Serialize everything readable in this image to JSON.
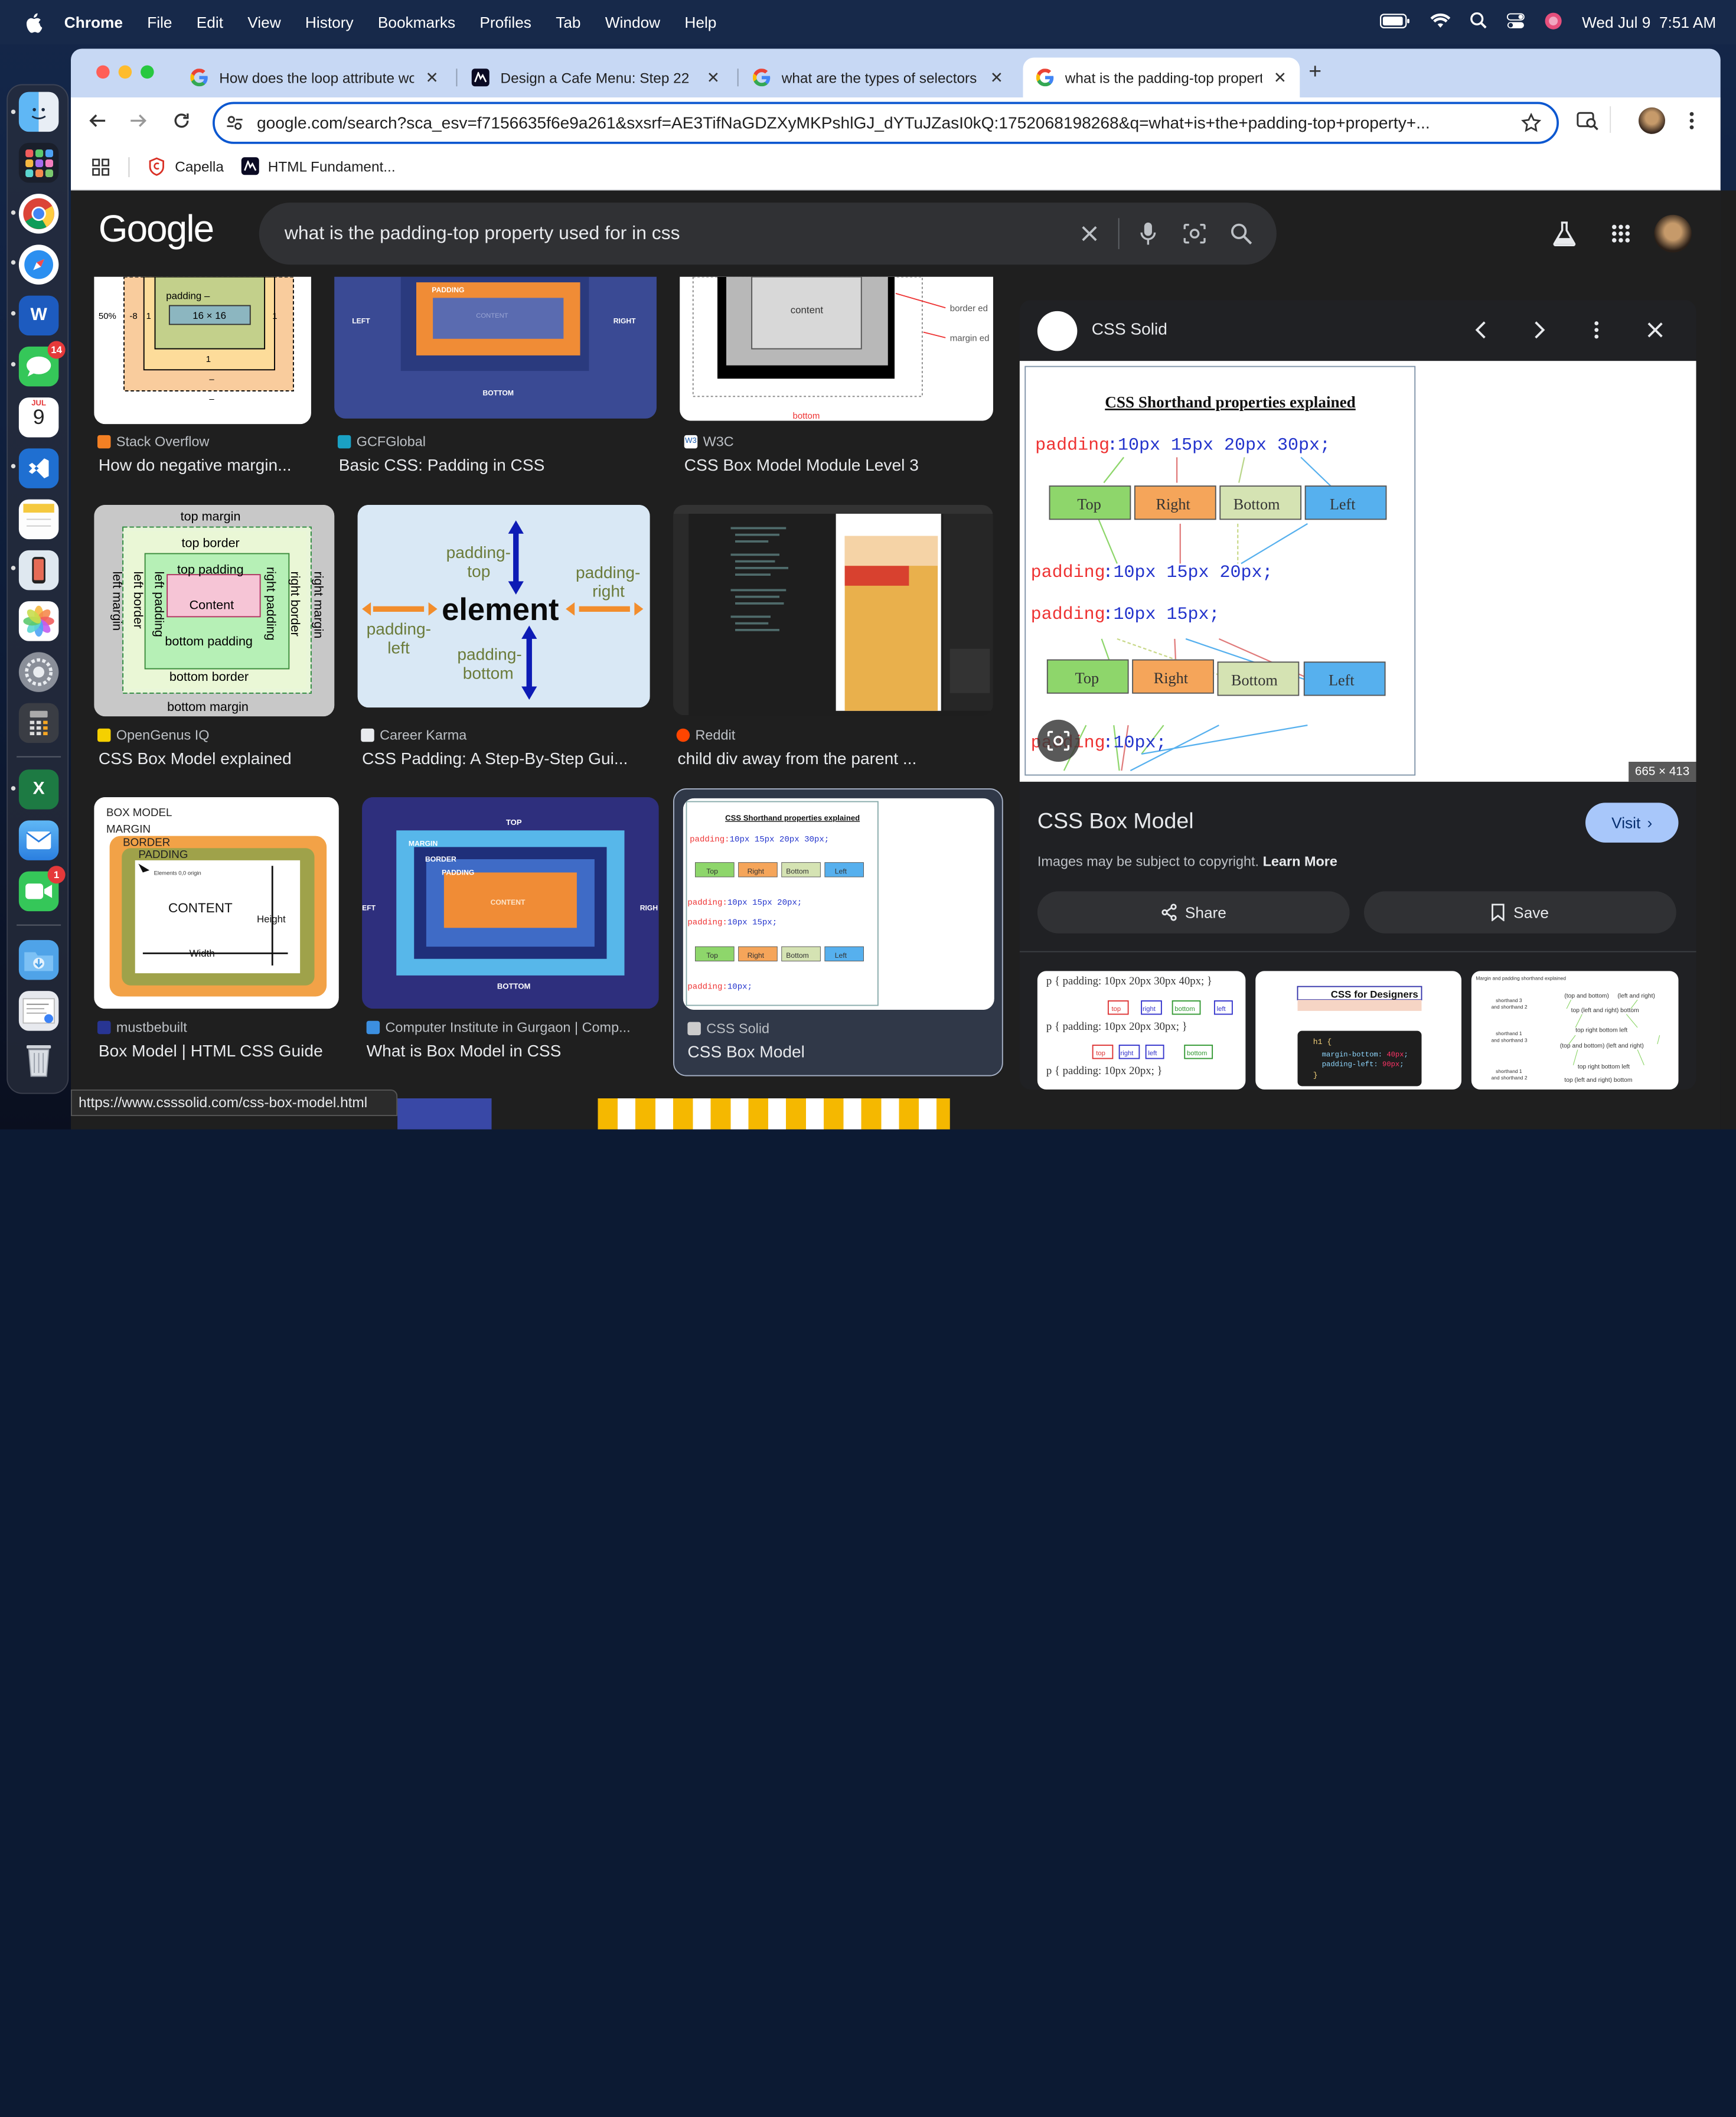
{
  "menubar": {
    "app_name": "Chrome",
    "items": [
      "File",
      "Edit",
      "View",
      "History",
      "Bookmarks",
      "Profiles",
      "Tab",
      "Window",
      "Help"
    ],
    "datetime": "Wed Jul 9  7:51 AM"
  },
  "dock": {
    "calendar_month": "JUL",
    "calendar_day": "9",
    "messages_badge": "14",
    "facetime_badge": "1"
  },
  "tabs": [
    {
      "title": "How does the loop attribute work",
      "active": false
    },
    {
      "title": "Design a Cafe Menu: Step 22",
      "active": false
    },
    {
      "title": "what are the types of selectors",
      "active": false
    },
    {
      "title": "what is the padding-top property",
      "active": true
    }
  ],
  "omnibox": {
    "url": "google.com/search?sca_esv=f7156635f6e9a261&sxsrf=AE3TifNaGDZXyMKPshlGJ_dYTuJZasI0kQ:1752068198268&q=what+is+the+padding-top+property+..."
  },
  "bookmarks": [
    {
      "label": "Capella"
    },
    {
      "label": "HTML Fundament..."
    }
  ],
  "google": {
    "logo": "Google",
    "query": "what is the padding-top property used for in css"
  },
  "results": [
    {
      "source": "Stack Overflow",
      "title": "How do negative margin...",
      "thumb": {
        "labels": [
          "padding –",
          "16 × 16",
          "50%",
          "-8",
          "1",
          "1",
          "1",
          "–",
          "–",
          "–",
          "1",
          "–",
          "–"
        ]
      }
    },
    {
      "source": "GCFGlobal",
      "title": "Basic CSS: Padding in CSS",
      "thumb": {
        "labels": [
          "PADDING",
          "LEFT",
          "RIGHT",
          "BOTTOM",
          "CONTENT"
        ]
      }
    },
    {
      "source": "W3C",
      "title": "CSS Box Model Module Level 3",
      "thumb": {
        "labels": [
          "content",
          "border ed",
          "margin ed",
          "bottom"
        ]
      }
    },
    {
      "source": "OpenGenus IQ",
      "title": "CSS Box Model explained",
      "thumb": {
        "labels": [
          "top margin",
          "top border",
          "top padding",
          "Content",
          "bottom padding",
          "bottom border",
          "bottom margin",
          "left margin",
          "left border",
          "left padding",
          "right padding",
          "right border",
          "right margin"
        ]
      }
    },
    {
      "source": "Career Karma",
      "title": "CSS Padding: A Step-By-Step Gui...",
      "thumb": {
        "labels": [
          "padding-top",
          "padding-right",
          "element",
          "padding-left",
          "padding-bottom"
        ]
      }
    },
    {
      "source": "Reddit",
      "title": "child div away from the parent ...",
      "thumb": {
        "labels": []
      }
    },
    {
      "source": "mustbebuilt",
      "title": "Box Model | HTML CSS Guide",
      "thumb": {
        "labels": [
          "BOX MODEL",
          "MARGIN",
          "BORDER",
          "PADDING",
          "Elements 0,0 origin",
          "CONTENT",
          "Height",
          "Width"
        ]
      }
    },
    {
      "source": "Computer Institute in Gurgaon | Comp...",
      "title": "What is Box Model in CSS",
      "thumb": {
        "labels": [
          "TOP",
          "MARGIN",
          "BORDER",
          "PADDING",
          "CONTENT",
          "EFT",
          "RIGH",
          "BOTTOM"
        ]
      }
    },
    {
      "source": "CSS Solid",
      "title": "CSS Box Model",
      "thumb": {
        "labels": [
          "CSS Shorthand properties explained",
          "padding:10px 15px 20px 30px;",
          "Top",
          "Right",
          "Bottom",
          "Left",
          "padding:10px 15px 20px;",
          "padding:10px 15px;",
          "Top",
          "Right",
          "Bottom",
          "Left",
          "padding:10px;"
        ]
      }
    }
  ],
  "status_url": "https://www.csssolid.com/css-box-model.html",
  "panel": {
    "source": "CSS Solid",
    "dimensions": "665 × 413",
    "title": "CSS Box Model",
    "visit_label": "Visit",
    "copyright": "Images may be subject to copyright.",
    "learn_more": "Learn More",
    "share_label": "Share",
    "save_label": "Save",
    "figure": {
      "heading": "CSS Shorthand properties explained",
      "line1_prop": "padding",
      "line1_vals": ":10px 15px 20px 30px;",
      "boxes": [
        "Top",
        "Right",
        "Bottom",
        "Left"
      ],
      "line2_prop": "padding",
      "line2_vals": ":10px 15px 20px;",
      "line3_prop": "padding",
      "line3_vals": ":10px 15px;",
      "line4_prop": "padding",
      "line4_vals": ":10px;"
    },
    "related": [
      {
        "lines": [
          "p { padding: 10px   20px   30px   40px; }",
          "top",
          "right",
          "bottom",
          "left",
          "p { padding: 10px   20px   30px; }",
          "top",
          "right",
          "left",
          "bottom",
          "p { padding: 10px   20px; }"
        ]
      },
      {
        "lines": [
          "CSS for Designers",
          "h1 {",
          "margin-bottom: 40px;",
          "padding-left: 90px;",
          "}"
        ]
      },
      {
        "lines": [
          "Margin and padding shorthand explained",
          "(top and bottom)",
          "(left and right)",
          "top",
          "(left and right)",
          "bottom",
          "top right bottom left",
          "(top and bottom)",
          "(left and right)",
          "top right bottom left",
          "top",
          "(left and right)",
          "bottom",
          "shorthand 3",
          "and shorthand 2",
          "shorthand 1",
          "and shorthand 3",
          "shorthand 1",
          "and shorthand 2"
        ]
      }
    ]
  },
  "colors": {
    "google_blue": "#0b57d0",
    "tab_strip": "#c7d8f4",
    "page_bg": "#1f1f1f",
    "visit_btn": "#a8c7fa"
  }
}
